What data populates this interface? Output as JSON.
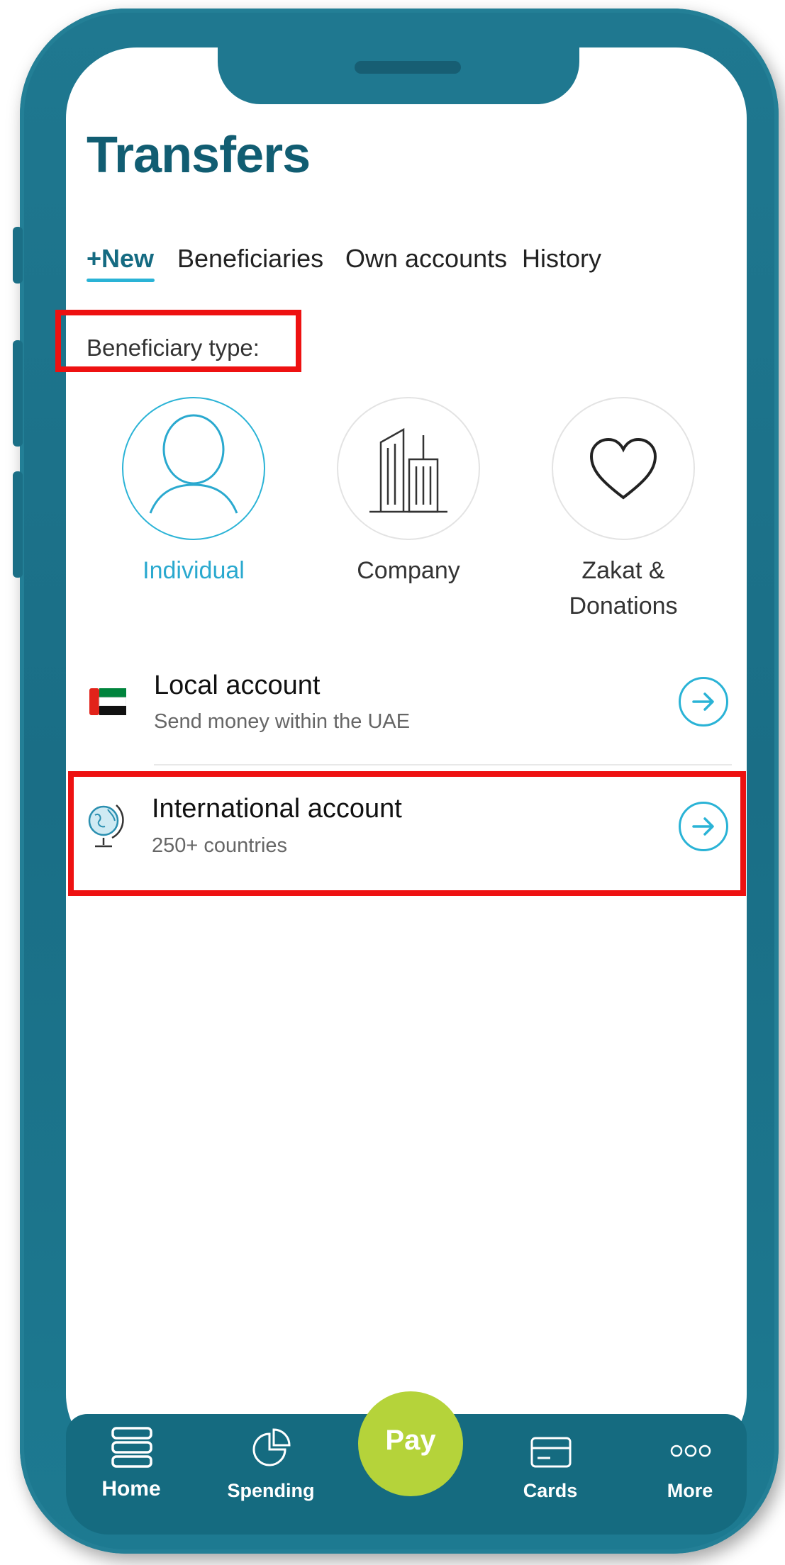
{
  "header": {
    "title": "Transfers"
  },
  "tabs": [
    {
      "label": "+New"
    },
    {
      "label": "Beneficiaries"
    },
    {
      "label": "Own accounts"
    },
    {
      "label": "History"
    }
  ],
  "beneficiary": {
    "label": "Beneficiary type:",
    "types": [
      {
        "label": "Individual",
        "icon": "person-icon"
      },
      {
        "label": "Company",
        "icon": "building-icon"
      },
      {
        "label": "Zakat &",
        "label2": "Donations",
        "icon": "heart-icon"
      }
    ]
  },
  "accounts": [
    {
      "title": "Local account",
      "subtitle": "Send money within the UAE",
      "icon": "uae-flag-icon"
    },
    {
      "title": "International account",
      "subtitle": "250+ countries",
      "icon": "globe-icon"
    }
  ],
  "nav": {
    "home": "Home",
    "spending": "Spending",
    "pay": "Pay",
    "cards": "Cards",
    "more": "More"
  },
  "colors": {
    "accent": "#2ab3d6",
    "primary": "#115d72",
    "pay": "#b5d33a",
    "highlight": "#ee1111"
  }
}
